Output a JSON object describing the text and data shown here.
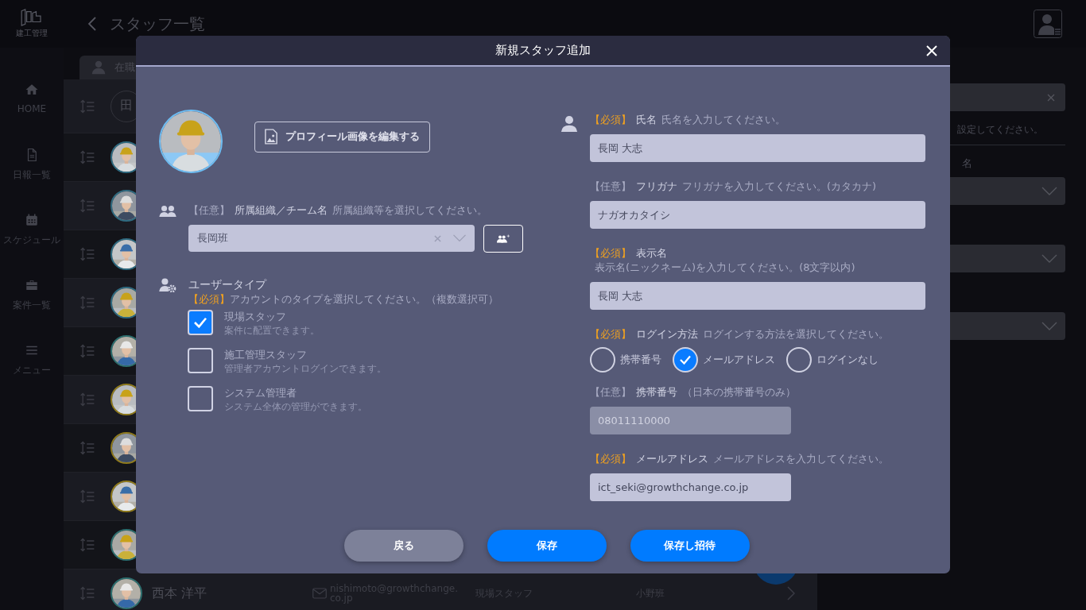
{
  "header": {
    "logo_text": "建工管理",
    "title": "スタッフ一覧"
  },
  "sidebar": {
    "items": [
      {
        "kind": "home",
        "label": "HOME"
      },
      {
        "kind": "document",
        "label": "日報一覧"
      },
      {
        "kind": "calendar",
        "label": "スケジュール"
      },
      {
        "kind": "briefcase",
        "label": "案件一覧"
      },
      {
        "kind": "menu",
        "label": "メニュー"
      }
    ]
  },
  "staff_list": {
    "tabs": [
      {
        "label": "在職",
        "selected": true
      }
    ],
    "filter_badge": "田",
    "rows": [
      {
        "color": "#2e6a80"
      },
      {
        "color": "#2e6a80"
      },
      {
        "color": "#2e6a80"
      },
      {
        "color": "#2e6a80"
      },
      {
        "color": "#2c6e6e"
      },
      {
        "color": "#8f7a1c"
      },
      {
        "color": "#8f7a1c"
      },
      {
        "color": "#8f7a1c"
      },
      {
        "color": "#2c6e6e"
      },
      {
        "color": "#2c6e6e",
        "name": "西本 洋平",
        "email": "nishimoto@growthchange.co.jp",
        "user_type": "現場スタッフ",
        "team": "小野班"
      }
    ]
  },
  "right_panel": {
    "hint": "設定してください。",
    "label": "名"
  },
  "dialog": {
    "title": "新規スタッフ追加",
    "profile": {
      "kind": "picture",
      "edit_button": "プロフィール画像を編集する"
    },
    "organization": {
      "required": false,
      "tag": "【任意】",
      "label": "所属組織／チーム名",
      "hint": "所属組織等を選択してください。",
      "value": "長岡班"
    },
    "user_type": {
      "label": "ユーザータイプ",
      "required": true,
      "tag": "【必須】",
      "hint": "アカウントのタイプを選択してください。（複数選択可）",
      "options": [
        {
          "label": "現場スタッフ",
          "description": "案件に配置できます。",
          "checked": true
        },
        {
          "label": "施工管理スタッフ",
          "description": "管理者アカウントログインできます。",
          "checked": false
        },
        {
          "label": "システム管理者",
          "description": "システム全体の管理ができます。",
          "checked": false
        }
      ]
    },
    "fields": [
      {
        "kind": "text",
        "required": true,
        "tag": "【必須】",
        "label": "氏名",
        "hint": "氏名を入力してください。",
        "value": "長岡 大志"
      },
      {
        "kind": "text",
        "required": false,
        "tag": "【任意】",
        "label": "フリガナ",
        "hint": "フリガナを入力してください。(カタカナ)",
        "value": "ナガオカタイシ"
      },
      {
        "kind": "text",
        "required": true,
        "tag": "【必須】",
        "label": "表示名",
        "hint": "表示名(ニックネーム)を入力してください。(8文字以内)",
        "value": "長岡 大志"
      },
      {
        "kind": "radio",
        "required": true,
        "tag": "【必須】",
        "label": "ログイン方法",
        "hint": "ログインする方法を選択してください。",
        "options": [
          {
            "label": "携帯番号",
            "selected": false
          },
          {
            "label": "メールアドレス",
            "selected": true
          },
          {
            "label": "ログインなし",
            "selected": false
          }
        ]
      },
      {
        "kind": "short",
        "required": false,
        "tag": "【任意】",
        "label": "携帯番号",
        "hint": "（日本の携帯番号のみ）",
        "placeholder": "08011110000",
        "disabled": true
      },
      {
        "kind": "short",
        "required": true,
        "tag": "【必須】",
        "label": "メールアドレス",
        "hint": "メールアドレスを入力してください。",
        "value": "ict_seki@growthchange.co.jp",
        "disabled": false
      }
    ],
    "buttons": [
      {
        "kind": "secondary",
        "label": "戻る"
      },
      {
        "kind": "primary",
        "label": "保存"
      },
      {
        "kind": "primary",
        "label": "保存し招待"
      }
    ]
  }
}
